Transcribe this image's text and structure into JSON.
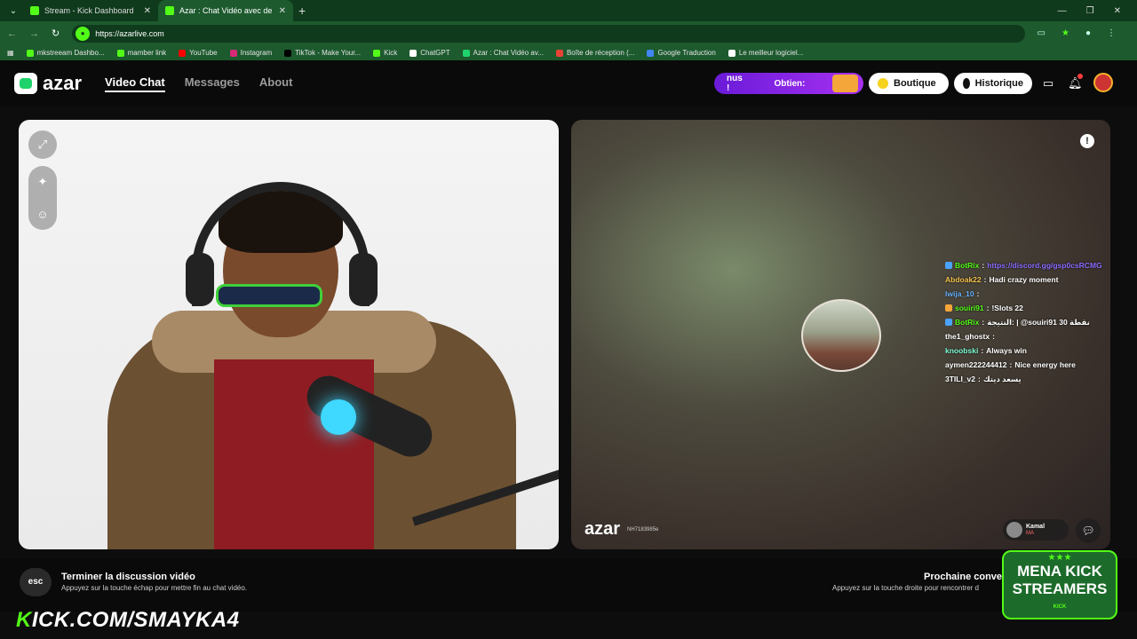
{
  "browser": {
    "tabs": [
      {
        "title": "Stream - Kick Dashboard",
        "active": false
      },
      {
        "title": "Azar : Chat Vidéo avec de n",
        "active": true
      }
    ],
    "url": "https://azarlive.com",
    "bookmarks": [
      "mkstreeam Dashbo...",
      "mamber link",
      "YouTube",
      "Instagram",
      "TikTok - Make Your...",
      "Kick",
      "ChatGPT",
      "Azar : Chat Vidéo av...",
      "Boîte de réception (...",
      "Google Traduction",
      "Le meilleur logiciel..."
    ]
  },
  "azar": {
    "logo": "azar",
    "nav": [
      {
        "label": "Video Chat",
        "active": true
      },
      {
        "label": "Messages",
        "active": false
      },
      {
        "label": "About",
        "active": false
      }
    ],
    "promo": {
      "text1": "nus !",
      "text2": "Obtien:"
    },
    "boutique": "Boutique",
    "historique": "Historique"
  },
  "remote": {
    "watermark": "azar",
    "watermark_id": "NH7183985e",
    "user_name": "Kamal",
    "country": "MA"
  },
  "chat": [
    {
      "user": "BotRix",
      "msg": "https://discord.gg/gsp0csRCMG",
      "user_color": "#53fc18",
      "msg_color": "#8a6cff"
    },
    {
      "user": "Abdoak22",
      "msg": "Hadi crazy moment",
      "user_color": "#f4c24a",
      "msg_color": "#ffffff"
    },
    {
      "user": "lwija_10",
      "msg": "",
      "user_color": "#6ab4ff",
      "msg_color": "#ffffff"
    },
    {
      "user": "souiri91",
      "msg": "!Slots 22",
      "user_color": "#53fc18",
      "msg_color": "#ffffff"
    },
    {
      "user": "BotRix",
      "msg": "النتيجة: | @souiri91 نقطة 30",
      "user_color": "#53fc18",
      "msg_color": "#ffffff"
    },
    {
      "user": "the1_ghostx",
      "msg": "",
      "user_color": "#ffffff",
      "msg_color": "#ffffff"
    },
    {
      "user": "knoobski",
      "msg": "Always win",
      "user_color": "#7fffd4",
      "msg_color": "#ffffff"
    },
    {
      "user": "aymen222244412",
      "msg": "Nice energy here",
      "user_color": "#ffffff",
      "msg_color": "#ffffff"
    },
    {
      "user": "3TILI_v2",
      "msg": "يسعد ديتك",
      "user_color": "#ffffff",
      "msg_color": "#ffffff"
    }
  ],
  "controls": {
    "esc_label": "esc",
    "end_title": "Terminer la discussion vidéo",
    "end_sub": "Appuyez sur la touche échap pour mettre fin au chat vidéo.",
    "next_title": "Prochaine conve",
    "next_sub": "Appuyez sur la touche droite pour rencontrer d"
  },
  "overlay": {
    "kick_k": "K",
    "kick_url": "ICK.COM/SMAYKA4",
    "mena_line1": "MENA KICK",
    "mena_line2": "STREAMERS",
    "mena_sub": "KICK"
  }
}
